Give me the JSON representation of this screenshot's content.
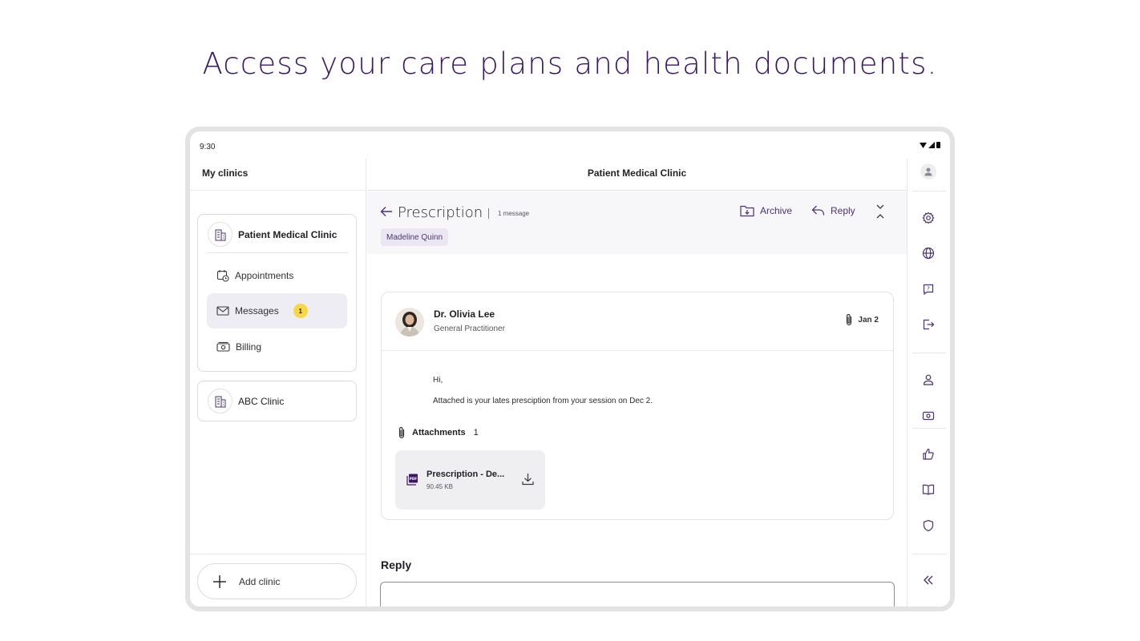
{
  "headline": "Access your care plans and health documents.",
  "status_bar": {
    "time": "9:30"
  },
  "sidebar": {
    "title": "My clinics",
    "clinics": [
      {
        "name": "Patient Medical Clinic",
        "items": [
          {
            "label": "Appointments",
            "icon": "calendar-clock-icon"
          },
          {
            "label": "Messages",
            "icon": "envelope-icon",
            "badge": "1"
          },
          {
            "label": "Billing",
            "icon": "cash-icon"
          }
        ]
      },
      {
        "name": "ABC Clinic"
      }
    ],
    "add_clinic_label": "Add clinic"
  },
  "main": {
    "clinic_title": "Patient Medical Clinic",
    "subject": "Prescription",
    "message_count": "1 message",
    "participant_tag": "Madeline Quinn",
    "actions": {
      "archive": "Archive",
      "reply": "Reply"
    },
    "message": {
      "sender": "Dr. Olivia Lee",
      "role": "General Practitioner",
      "date": "Jan 2",
      "body": [
        "Hi,",
        "Attached is your lates presciption from your session on Dec 2."
      ],
      "attachments_label": "Attachments",
      "attachments_count": "1",
      "file": {
        "name": "Prescription - De...",
        "size": "90.45 KB"
      }
    },
    "reply_label": "Reply"
  },
  "colors": {
    "brand_purple": "#3a1669",
    "accent": "#4a3277",
    "badge": "#f8d644"
  }
}
